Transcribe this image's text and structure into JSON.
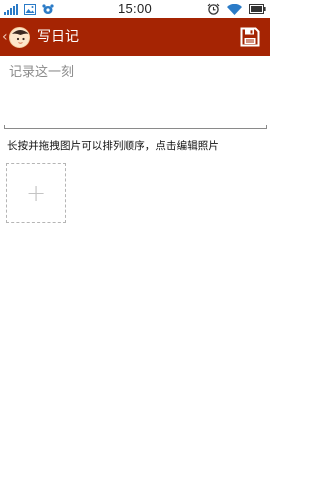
{
  "status_bar": {
    "time": "15:00",
    "left_icons": [
      "signal-icon",
      "image-icon",
      "notification-icon"
    ],
    "right_icons": [
      "alarm-icon",
      "wifi-icon",
      "battery-icon"
    ]
  },
  "header": {
    "title": "写日记",
    "back_icon": "chevron-left-icon",
    "avatar_icon": "face-avatar",
    "save_icon": "save-icon",
    "background_color": "#a52403"
  },
  "editor": {
    "placeholder": "记录这一刻",
    "value": ""
  },
  "photos": {
    "hint": "长按并拖拽图片可以排列顺序，点击编辑照片",
    "add_symbol": "+"
  }
}
